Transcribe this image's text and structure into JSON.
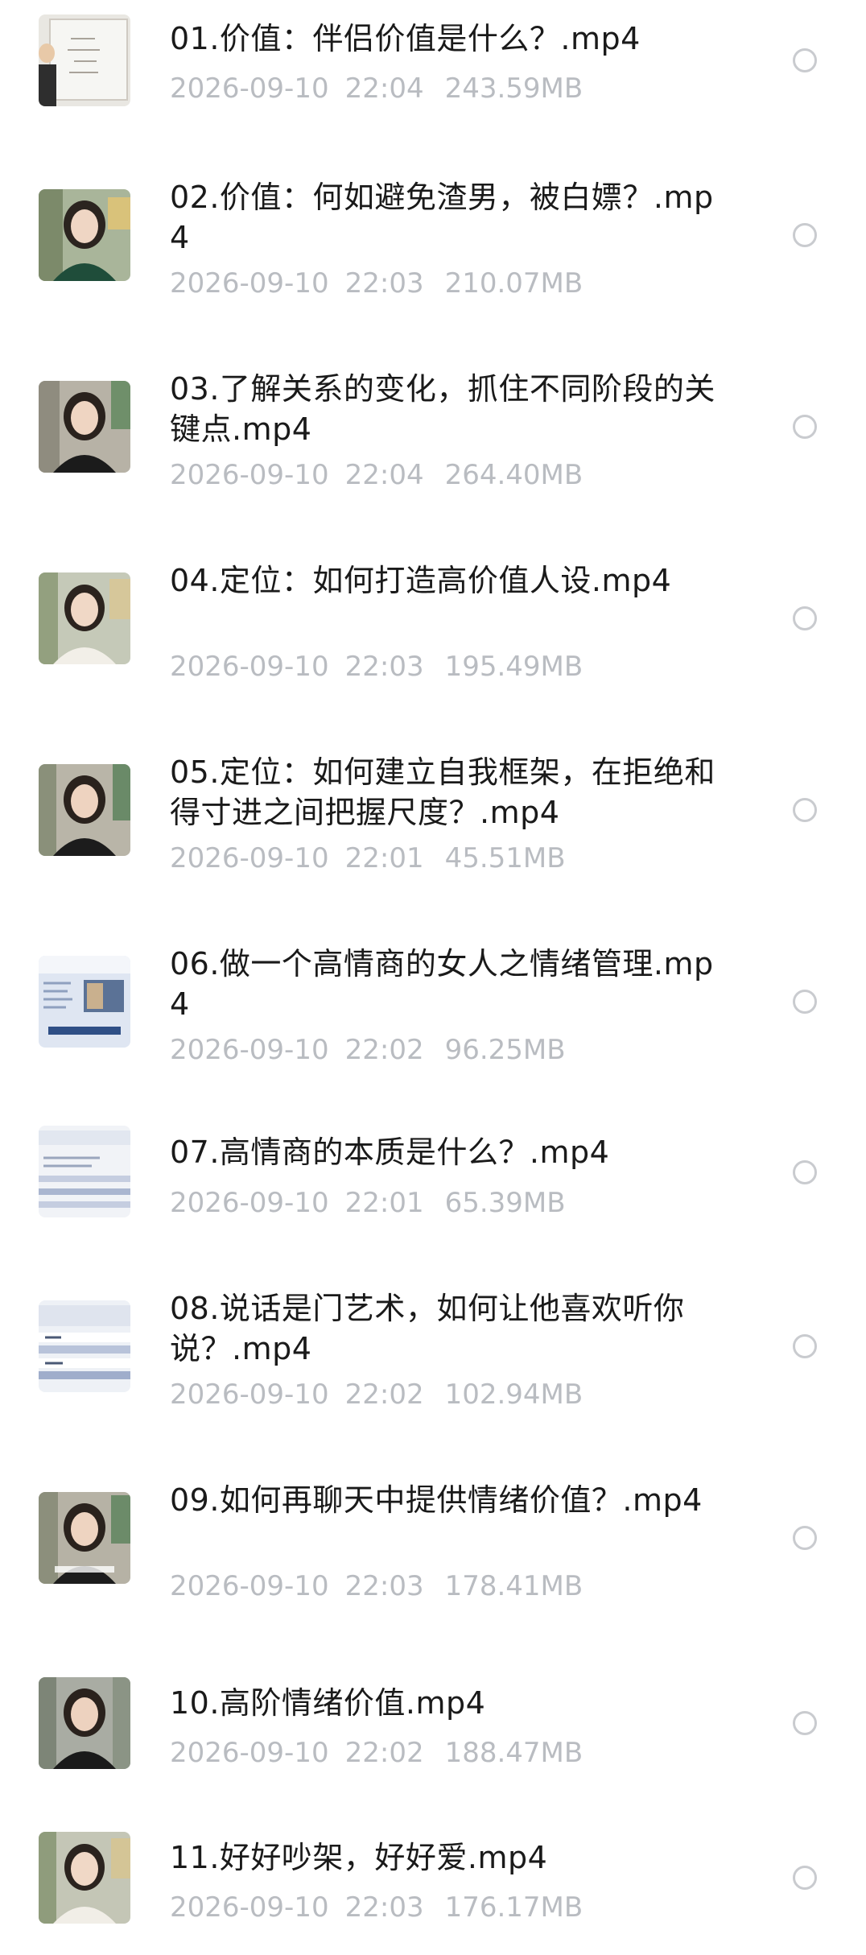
{
  "files": [
    {
      "name": "01.价值：伴侣价值是什么？.mp4",
      "date": "2026-09-10",
      "time": "22:04",
      "size": "243.59MB",
      "thumb": "whiteboard"
    },
    {
      "name": "02.价值：何如避免渣男，被白嫖？.mp4",
      "date": "2026-09-10",
      "time": "22:03",
      "size": "210.07MB",
      "thumb": "presenter-green"
    },
    {
      "name": "03.了解关系的变化，抓住不同阶段的关键点.mp4",
      "date": "2026-09-10",
      "time": "22:04",
      "size": "264.40MB",
      "thumb": "presenter-black"
    },
    {
      "name": "04.定位：如何打造高价值人设.mp4",
      "date": "2026-09-10",
      "time": "22:03",
      "size": "195.49MB",
      "thumb": "presenter-white"
    },
    {
      "name": "05.定位：如何建立自我框架，在拒绝和得寸进之间把握尺度？.mp4",
      "date": "2026-09-10",
      "time": "22:01",
      "size": "45.51MB",
      "thumb": "presenter-black"
    },
    {
      "name": "06.做一个高情商的女人之情绪管理.mp4",
      "date": "2026-09-10",
      "time": "22:02",
      "size": "96.25MB",
      "thumb": "slide-blue"
    },
    {
      "name": "07.高情商的本质是什么？.mp4",
      "date": "2026-09-10",
      "time": "22:01",
      "size": "65.39MB",
      "thumb": "slide-list"
    },
    {
      "name": "08.说话是门艺术，如何让他喜欢听你说？.mp4",
      "date": "2026-09-10",
      "time": "22:02",
      "size": "102.94MB",
      "thumb": "slide-list"
    },
    {
      "name": "09.如何再聊天中提供情绪价值？.mp4",
      "date": "2026-09-10",
      "time": "22:03",
      "size": "178.41MB",
      "thumb": "presenter-black"
    },
    {
      "name": "10.高阶情绪价值.mp4",
      "date": "2026-09-10",
      "time": "22:02",
      "size": "188.47MB",
      "thumb": "presenter-black"
    },
    {
      "name": "11.好好吵架，好好爱.mp4",
      "date": "2026-09-10",
      "time": "22:03",
      "size": "176.17MB",
      "thumb": "presenter-white"
    }
  ],
  "colors": {
    "name_text": "#1a1a1a",
    "meta_text": "#b9bcc1",
    "radio_border": "#c9cbcf"
  }
}
